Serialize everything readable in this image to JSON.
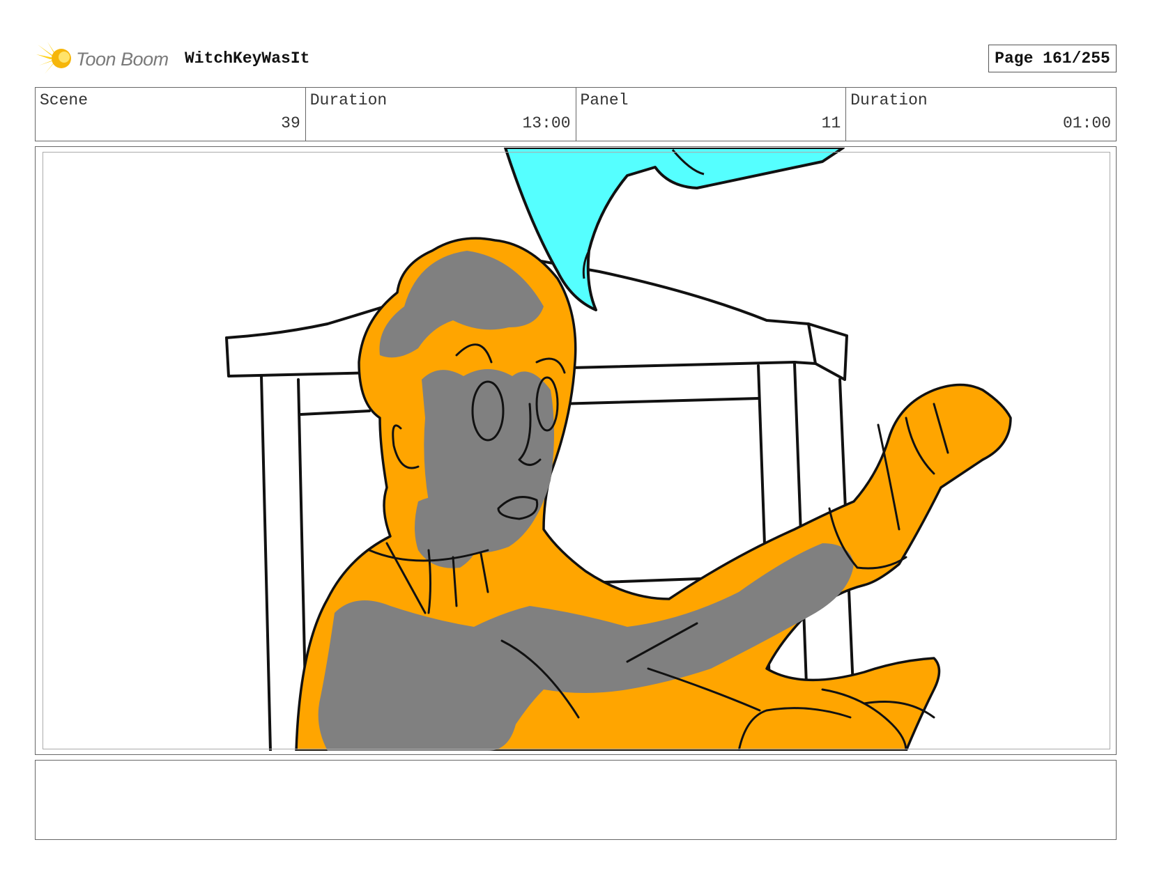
{
  "header": {
    "logo_text": "Toon Boom",
    "project_title": "WitchKeyWasIt",
    "page_label": "Page 161/255"
  },
  "info": {
    "scene_label": "Scene",
    "scene_value": "39",
    "scene_duration_label": "Duration",
    "scene_duration_value": "13:00",
    "panel_label": "Panel",
    "panel_value": "11",
    "panel_duration_label": "Duration",
    "panel_duration_value": "01:00"
  },
  "colors": {
    "skin_orange": "#FFA500",
    "shadow_gray": "#808080",
    "cyan": "#55FFFF",
    "line": "#111111"
  },
  "notes": ""
}
